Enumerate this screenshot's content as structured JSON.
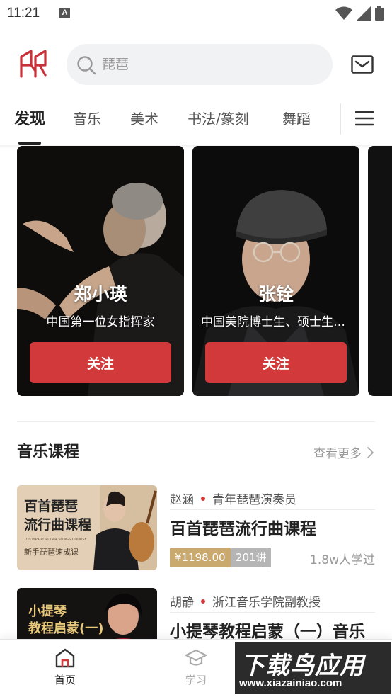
{
  "status_bar": {
    "time": "11:21",
    "notification_badge": "A",
    "icons": [
      "wifi-icon",
      "signal-icon",
      "battery-icon"
    ]
  },
  "header": {
    "logo_icon": "app-logo-icon",
    "search": {
      "placeholder": "琵琶",
      "value": ""
    },
    "mail_icon": "mail-icon"
  },
  "tabs": {
    "items": [
      "发现",
      "音乐",
      "美术",
      "书法/篆刻",
      "舞蹈"
    ],
    "active": "发现",
    "menu_icon": "menu-icon"
  },
  "featured": [
    {
      "name": "郑小瑛",
      "desc": "中国第一位女指挥家",
      "button": "关注"
    },
    {
      "name": "张铨",
      "desc": "中国美院博士生、硕士生导师",
      "button": "关注"
    }
  ],
  "music_courses": {
    "title": "音乐课程",
    "see_more": "查看更多",
    "items": [
      {
        "teacher": "赵涵",
        "teacher_title": "青年琵琶演奏员",
        "title": "百首琵琶流行曲课程",
        "price": "¥1198.00",
        "lessons": "201讲",
        "learners": "1.8w人学过",
        "thumb_title_1": "百首琵琶",
        "thumb_title_2": "流行曲课程",
        "thumb_sub": "100 PIPA POPULAR SONGS COURSE",
        "thumb_tag": "新手琵琶速成课"
      },
      {
        "teacher": "胡静",
        "teacher_title": "浙江音乐学院副教授",
        "title": "小提琴教程启蒙（一）音乐",
        "thumb_title_1": "小提琴",
        "thumb_title_2": "教程启蒙(一)"
      }
    ]
  },
  "bottom_nav": {
    "items": [
      {
        "label": "首页",
        "icon": "home-icon",
        "active": true
      },
      {
        "label": "学习",
        "icon": "study-icon",
        "active": false
      }
    ]
  },
  "watermark": {
    "title": "下载鸟应用",
    "url": "www.xiazainiao.com"
  },
  "colors": {
    "accent": "#d1393a",
    "price_tag": "#c9a96e",
    "lessons_tag": "#b5b5b5"
  }
}
